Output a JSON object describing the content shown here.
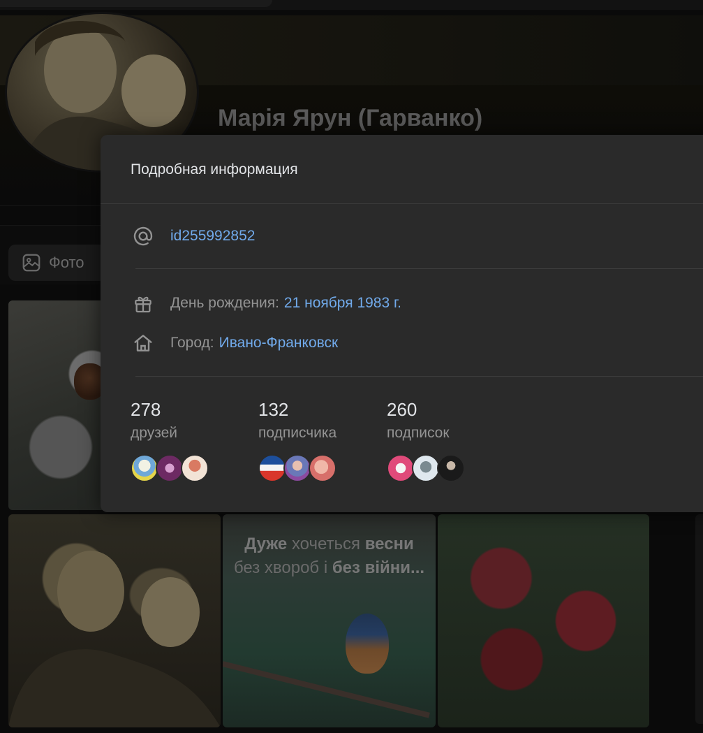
{
  "profile": {
    "name": "Марія Ярун (Гарванко)"
  },
  "tabs": {
    "photo_label": "Фото"
  },
  "photos": {
    "bird_post_line1_bold1": "Дуже",
    "bird_post_line1_regular": "хочеться",
    "bird_post_line1_bold2": "весни",
    "bird_post_line2_regular": "без хвороб і",
    "bird_post_line2_bold": "без війни..."
  },
  "popup": {
    "title": "Подробная информация",
    "username": "id255992852",
    "birthday_label": "День рождения:",
    "birthday_value": "21 ноября 1983 г.",
    "city_label": "Город:",
    "city_value": "Ивано-Франковск",
    "stats": [
      {
        "count": "278",
        "label": "друзей"
      },
      {
        "count": "132",
        "label": "подписчика"
      },
      {
        "count": "260",
        "label": "подписок"
      }
    ]
  },
  "icons": {
    "at": "at-icon",
    "gift": "gift-icon",
    "home": "home-icon",
    "photo": "image-icon"
  },
  "colors": {
    "link": "#71aaeb",
    "popup_bg": "#2a2a2a",
    "muted_text": "#939393",
    "primary_text": "#e1e3e6"
  }
}
